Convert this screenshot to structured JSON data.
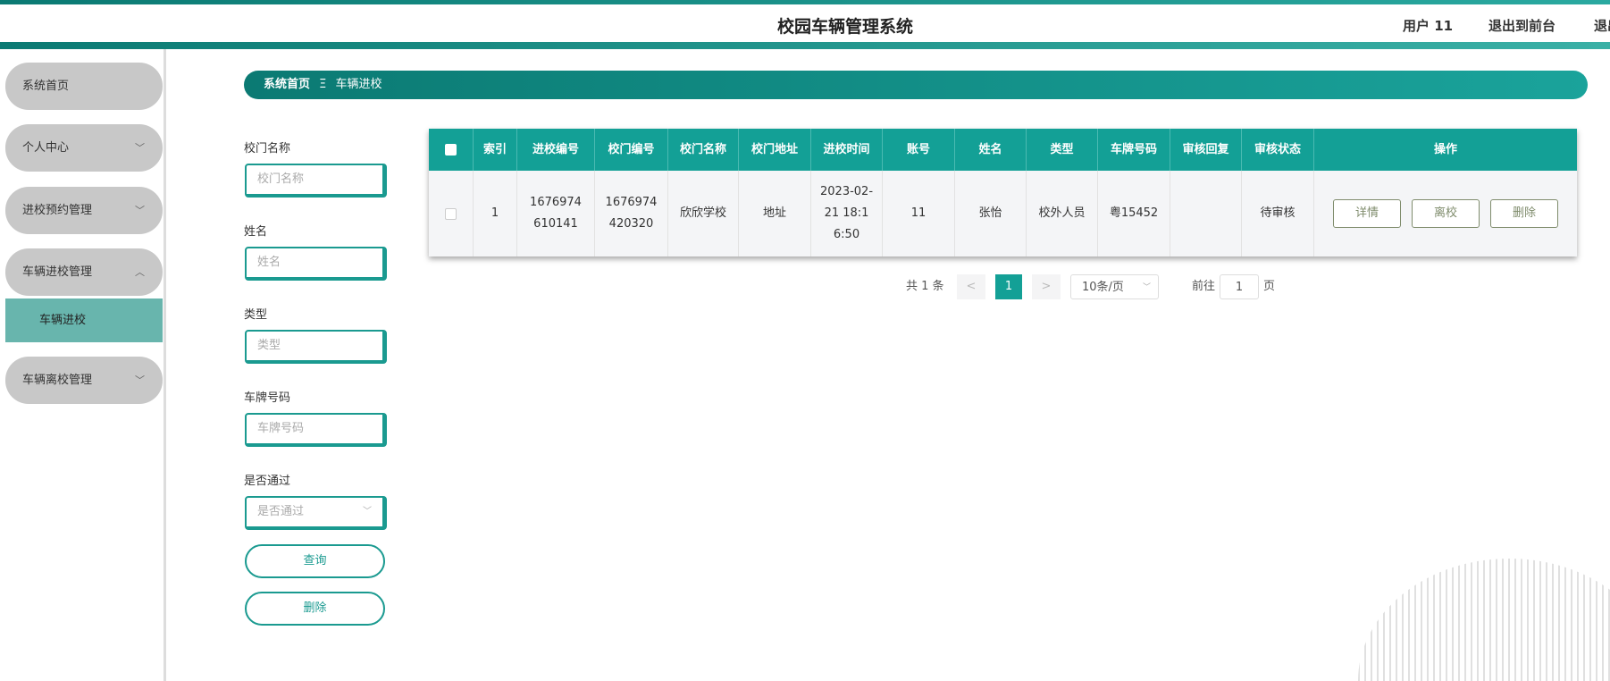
{
  "header": {
    "title": "校园车辆管理系统",
    "user": "用户 11",
    "exit_front": "退出到前台",
    "logout": "退出登录"
  },
  "sidebar": {
    "items": [
      {
        "label": "系统首页"
      },
      {
        "label": "个人中心"
      },
      {
        "label": "进校预约管理"
      },
      {
        "label": "车辆进校管理"
      },
      {
        "label": "车辆离校管理"
      }
    ],
    "sub_item": "车辆进校"
  },
  "breadcrumb": {
    "home": "系统首页",
    "sep": "Ξ",
    "current": "车辆进校"
  },
  "search": {
    "fields": [
      {
        "label": "校门名称",
        "placeholder": "校门名称"
      },
      {
        "label": "姓名",
        "placeholder": "姓名"
      },
      {
        "label": "类型",
        "placeholder": "类型"
      },
      {
        "label": "车牌号码",
        "placeholder": "车牌号码"
      },
      {
        "label": "是否通过",
        "placeholder": "是否通过"
      }
    ],
    "query": "查询",
    "delete": "删除"
  },
  "table": {
    "headers": [
      "索引",
      "进校编号",
      "校门编号",
      "校门名称",
      "校门地址",
      "进校时间",
      "账号",
      "姓名",
      "类型",
      "车牌号码",
      "审核回复",
      "审核状态",
      "操作"
    ],
    "rows": [
      {
        "cells": [
          "1",
          "1676974610141",
          "1676974420320",
          "欣欣学校",
          "地址",
          "2023-02-21 18:16:50",
          "11",
          "张怡",
          "校外人员",
          "粤15452",
          "",
          "待审核"
        ],
        "actions": [
          "详情",
          "离校",
          "删除"
        ]
      }
    ]
  },
  "pagination": {
    "total": "共 1 条",
    "prev": "<",
    "page": "1",
    "next": ">",
    "size": "10条/页",
    "goto": "前往",
    "goto_value": "1",
    "page_unit": "页"
  },
  "colors": {
    "accent": "#13a096",
    "sidebar_item": "#c8c8c8"
  }
}
